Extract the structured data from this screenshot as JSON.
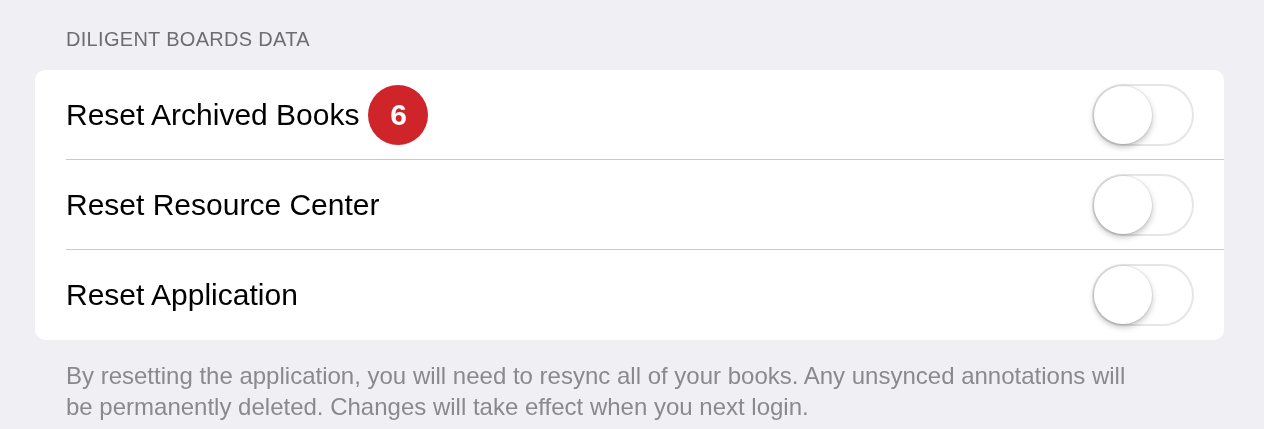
{
  "section": {
    "header": "DILIGENT BOARDS DATA",
    "rows": [
      {
        "label": "Reset Archived Books",
        "badge": "6",
        "on": false
      },
      {
        "label": "Reset Resource Center",
        "on": false
      },
      {
        "label": "Reset Application",
        "on": false
      }
    ],
    "footer": "By resetting the application, you will need to resync all of your books. Any unsynced annotations will be permanently deleted. Changes will take effect when you next login."
  }
}
